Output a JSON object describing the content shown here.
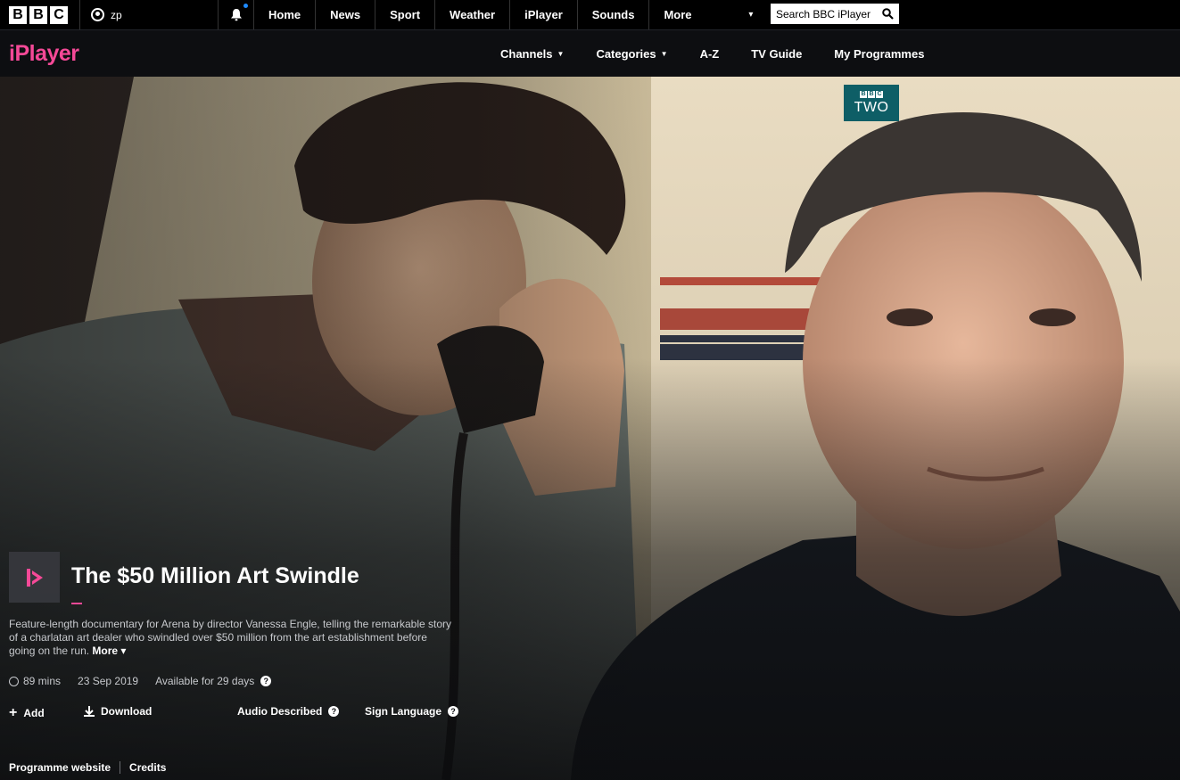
{
  "bbc_bar": {
    "logo_letters": [
      "B",
      "B",
      "C"
    ],
    "account_label": "zp",
    "nav": [
      "Home",
      "News",
      "Sport",
      "Weather",
      "iPlayer",
      "Sounds"
    ],
    "more_label": "More",
    "search_placeholder": "Search BBC iPlayer",
    "icons": {
      "account": "account-icon",
      "notifications": "bell-icon",
      "search": "search-icon"
    },
    "notification_dot_color": "#1e8bff"
  },
  "iplayer_nav": {
    "logo": "iPlayer",
    "logo_color": "#f54997",
    "items": [
      {
        "label": "Channels",
        "has_dropdown": true
      },
      {
        "label": "Categories",
        "has_dropdown": true
      },
      {
        "label": "A-Z",
        "has_dropdown": false
      },
      {
        "label": "TV Guide",
        "has_dropdown": false
      },
      {
        "label": "My Programmes",
        "has_dropdown": false
      }
    ]
  },
  "programme": {
    "channel_logo_text": "TWO",
    "channel_logo_bbc": [
      "B",
      "B",
      "C"
    ],
    "channel_color": "#0e5e66",
    "title": "The $50 Million Art Swindle",
    "description": "Feature-length documentary for Arena by director Vanessa Engle, telling the remarkable story of a charlatan art dealer who swindled over $50 million from the art establishment before going on the run.",
    "more_label": "More",
    "duration": "89 mins",
    "date": "23 Sep 2019",
    "availability": "Available for 29 days",
    "actions": {
      "add": "Add",
      "download": "Download",
      "audio_described": "Audio Described",
      "sign_language": "Sign Language"
    },
    "links": [
      "Programme website",
      "Credits"
    ]
  }
}
